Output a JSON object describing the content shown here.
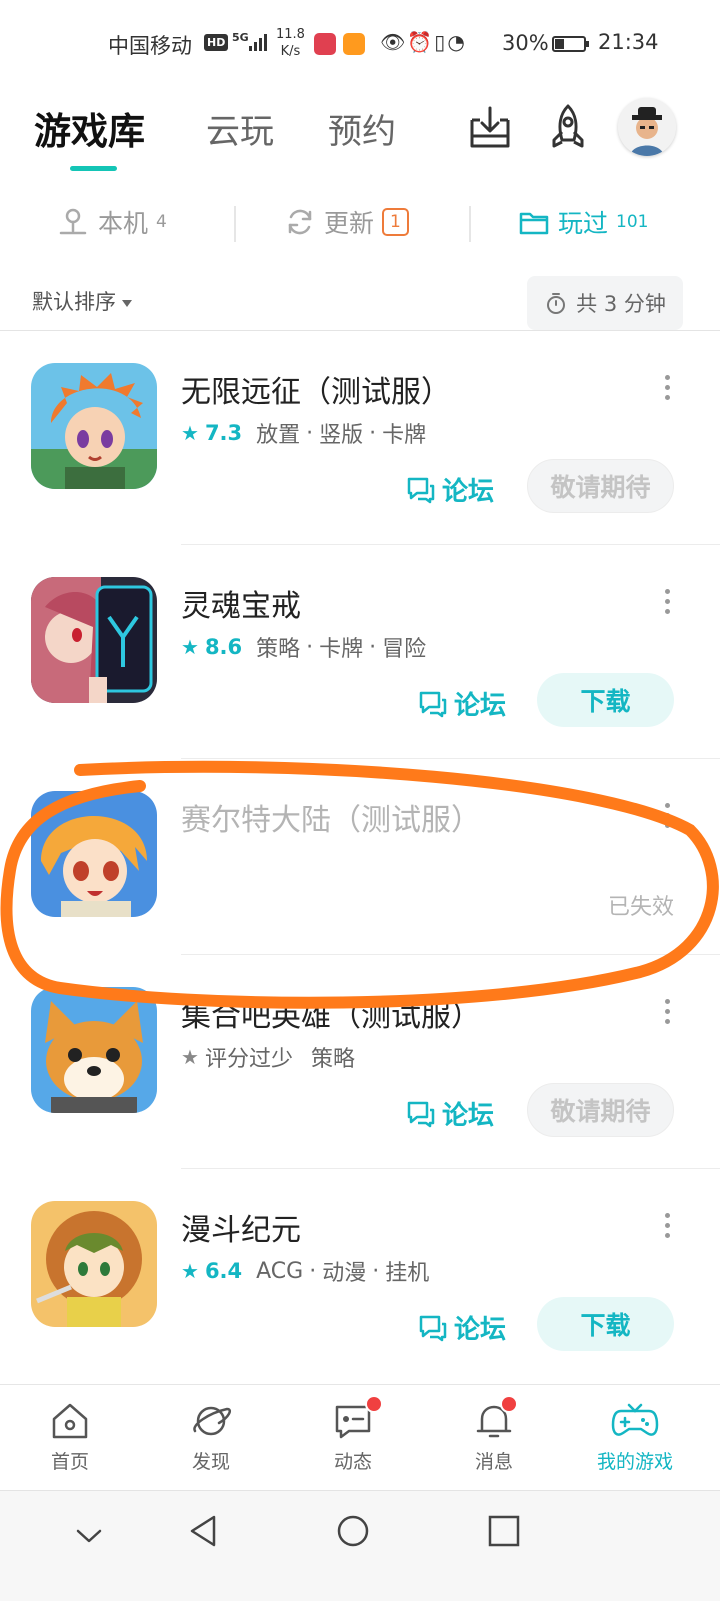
{
  "status_bar": {
    "carrier": "中国移动",
    "hd": "HD",
    "network": "5G",
    "speed_value": "11.8",
    "speed_unit": "K/s",
    "battery": "30%",
    "time": "21:34"
  },
  "header": {
    "tabs": [
      {
        "label": "游戏库",
        "active": true
      },
      {
        "label": "云玩",
        "active": false
      },
      {
        "label": "预约",
        "active": false
      }
    ],
    "icons": [
      "download-manager-icon",
      "rocket-icon",
      "avatar"
    ]
  },
  "filters": {
    "local": {
      "label": "本机",
      "count": "4"
    },
    "update": {
      "label": "更新",
      "count": "1"
    },
    "played": {
      "label": "玩过",
      "count": "101"
    }
  },
  "sort": {
    "label": "默认排序"
  },
  "total_time": "共 3 分钟",
  "games": [
    {
      "title": "无限远征（测试服）",
      "score": "7.3",
      "tags": [
        "放置",
        "竖版",
        "卡牌"
      ],
      "forum": "论坛",
      "action": "敬请期待",
      "action_type": "expect"
    },
    {
      "title": "灵魂宝戒",
      "score": "8.6",
      "tags": [
        "策略",
        "卡牌",
        "冒险"
      ],
      "forum": "论坛",
      "action": "下载",
      "action_type": "download"
    },
    {
      "title": "赛尔特大陆（测试服）",
      "status": "已失效",
      "invalid": true
    },
    {
      "title": "集合吧英雄（测试服）",
      "score_text": "评分过少",
      "tags": [
        "策略"
      ],
      "forum": "论坛",
      "action": "敬请期待",
      "action_type": "expect"
    },
    {
      "title": "漫斗纪元",
      "score": "6.4",
      "tags": [
        "ACG",
        "动漫",
        "挂机"
      ],
      "forum": "论坛",
      "action": "下载",
      "action_type": "download"
    }
  ],
  "bottom_nav": [
    {
      "label": "首页",
      "icon": "home-icon",
      "active": false,
      "dot": false
    },
    {
      "label": "发现",
      "icon": "planet-icon",
      "active": false,
      "dot": false
    },
    {
      "label": "动态",
      "icon": "chat-icon",
      "active": false,
      "dot": true
    },
    {
      "label": "消息",
      "icon": "bell-icon",
      "active": false,
      "dot": true
    },
    {
      "label": "我的游戏",
      "icon": "gamepad-icon",
      "active": true,
      "dot": false
    }
  ],
  "colors": {
    "accent": "#14b6c3",
    "tab_underline": "#14c5b6",
    "update_badge": "#ee7b3a",
    "annotation": "#ff7a1a",
    "red_dot": "#f04040"
  }
}
